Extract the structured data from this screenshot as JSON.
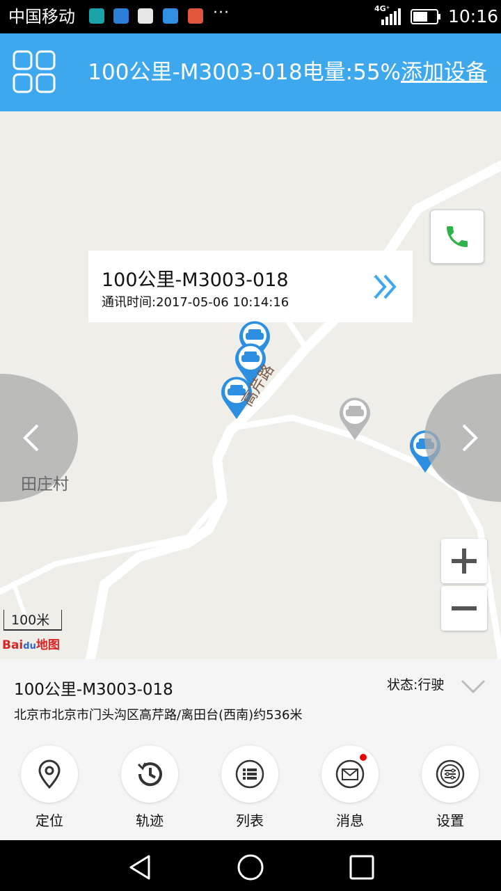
{
  "status_bar": {
    "carrier": "中国移动",
    "network": "4G⁺",
    "time": "10:16",
    "more": "···"
  },
  "header": {
    "device_name": "100公里-M3003-018",
    "battery_label": "电量:",
    "battery_value": "55%",
    "add_device": "添加设备"
  },
  "map": {
    "popup": {
      "device_name": "100公里-M3003-018",
      "comm_time": "通讯时间:2017-05-06 10:14:16"
    },
    "village_label": "田庄村",
    "road_label": "高芹路",
    "scale_label": "100米",
    "logo_text": "Bai 地图"
  },
  "info_panel": {
    "device_name": "100公里-M3003-018",
    "status": "状态:行驶",
    "address": "北京市北京市门头沟区高芹路/离田台(西南)约536米"
  },
  "actions": [
    {
      "label": "定位",
      "icon": "location-pin-icon"
    },
    {
      "label": "轨迹",
      "icon": "history-icon"
    },
    {
      "label": "列表",
      "icon": "list-icon"
    },
    {
      "label": "消息",
      "icon": "mail-icon"
    },
    {
      "label": "设置",
      "icon": "settings-icon"
    }
  ],
  "colors": {
    "accent": "#3ea8ee",
    "pin_active": "#2d8fe0",
    "pin_inactive": "#b8b8b8",
    "phone_green": "#2fb24a"
  }
}
